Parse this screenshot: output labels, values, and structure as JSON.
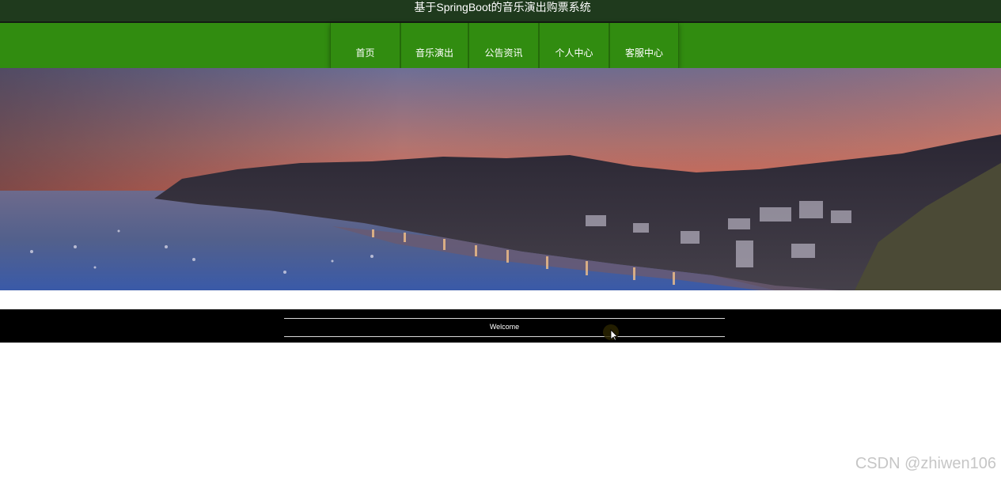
{
  "header": {
    "title": "基于SpringBoot的音乐演出购票系统"
  },
  "nav": {
    "items": [
      {
        "label": "首页"
      },
      {
        "label": "音乐演出"
      },
      {
        "label": "公告资讯"
      },
      {
        "label": "个人中心"
      },
      {
        "label": "客服中心"
      }
    ]
  },
  "banner": {
    "icon": "banner-image"
  },
  "welcome": {
    "text": "Welcome"
  },
  "watermark": {
    "text": "CSDN @zhiwen106"
  },
  "colors": {
    "top_bar": "#1f3a1d",
    "nav_bar": "#318c10",
    "welcome_bar": "#000000"
  }
}
